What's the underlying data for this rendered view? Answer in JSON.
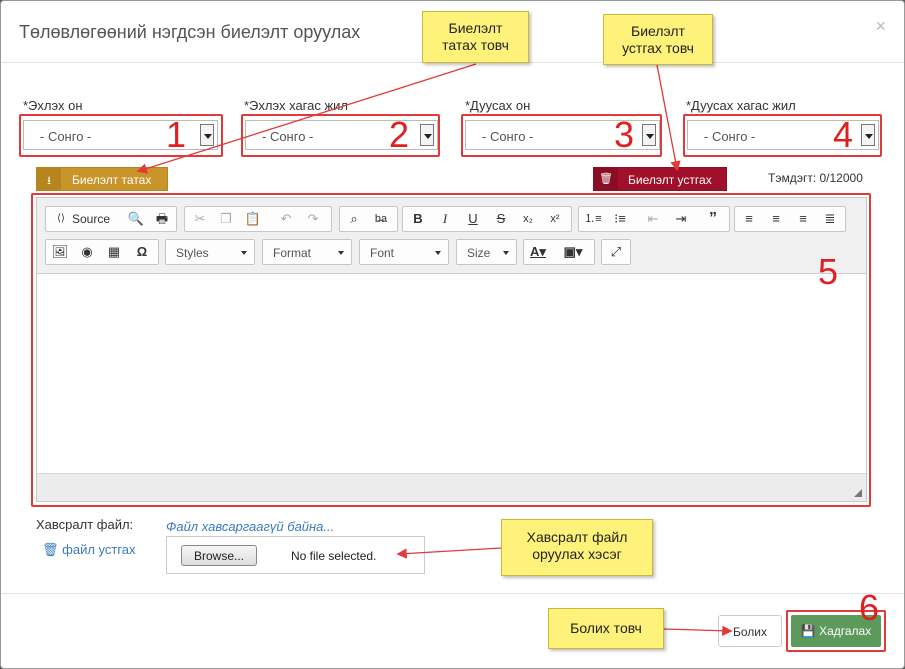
{
  "modal": {
    "title": "Төлөвлөгөөний нэгдсэн биелэлт оруулах",
    "close": "×"
  },
  "fields": [
    {
      "label": "*Эхлэх он",
      "value": "- Сонго -",
      "number": "1"
    },
    {
      "label": "*Эхлэх хагас жил",
      "value": "- Сонго -",
      "number": "2"
    },
    {
      "label": "*Дуусах он",
      "value": "- Сонго -",
      "number": "3"
    },
    {
      "label": "*Дуусах хагас жил",
      "value": "- Сонго -",
      "number": "4"
    }
  ],
  "actions": {
    "download_label": "Биелэлт татах",
    "delete_label": "Биелэлт устгах",
    "counter": "Тэмдэгт: 0/12000"
  },
  "editor": {
    "number": "5",
    "source_label": "Source",
    "styles_label": "Styles",
    "format_label": "Format",
    "font_label": "Font",
    "size_label": "Size"
  },
  "attachment": {
    "label": "Хавсралт файл:",
    "none": "Файл хавсаргаагүй байна...",
    "remove": "файл устгах",
    "browse": "Browse...",
    "no_file": "No file selected."
  },
  "footer": {
    "cancel": "Болих",
    "save": "Хадгалах",
    "number": "6"
  },
  "callouts": {
    "download": "Биелэлт татах товч",
    "delete": "Биелэлт устгах товч",
    "attach": "Хавсралт файл оруулах хэсэг",
    "cancel": "Болих товч"
  },
  "colors": {
    "annotation_red": "#e03a3a",
    "callout_yellow": "#fff27a",
    "download_button": "#c9952a",
    "delete_button": "#a0102a",
    "save_button": "#5c9a5c",
    "link_blue": "#3a7bbf"
  },
  "icons": {
    "download": "download-icon",
    "delete": "trash-icon",
    "remove_attachment": "trash-icon",
    "save": "floppy-disk-icon"
  }
}
